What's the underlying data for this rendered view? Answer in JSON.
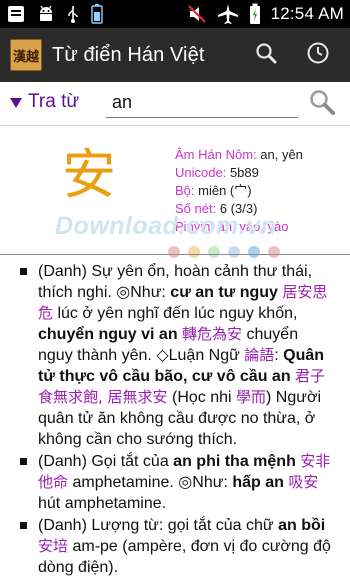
{
  "status_bar": {
    "time": "12:54 AM",
    "icons": [
      "notification-icon",
      "android-icon",
      "usb-icon",
      "battery-saver-icon",
      "mute-icon",
      "airplane-icon",
      "battery-icon"
    ]
  },
  "action_bar": {
    "logo_text": "漢越",
    "title": "Từ điển Hán Việt",
    "icons": [
      "search-icon",
      "history-icon"
    ]
  },
  "search": {
    "mode_label": "Tra từ",
    "query": "an"
  },
  "entry": {
    "character": "安",
    "labels": {
      "han_nom": "Âm Hán Nôm:",
      "unicode": "Unicode:",
      "radical": "Bộ:",
      "strokes": "Số nét:",
      "pinyin": "Pinyin:"
    },
    "values": {
      "han_nom": "an, yên",
      "unicode": "5b89",
      "radical": "miên (宀)",
      "strokes": "6 (3/3)",
      "pinyin": "ān, yāo, yào"
    }
  },
  "watermark": "Download.com.vn",
  "watermark_dot_colors": [
    "#f0c0c0",
    "#f4d8a8",
    "#c8e8c8",
    "#c8dcf0",
    "#a8d0f0",
    "#f0c0c0"
  ],
  "definitions": [
    {
      "parts": [
        {
          "t": "(Danh) Sự yên ổn, hoàn cảnh thư thái, thích nghi. ◎Như: ",
          "s": "n"
        },
        {
          "t": "cư an tư nguy",
          "s": "b"
        },
        {
          "t": " ",
          "s": "n"
        },
        {
          "t": "居安思危",
          "s": "c"
        },
        {
          "t": " lúc ở yên nghĩ đến lúc nguy khốn, ",
          "s": "n"
        },
        {
          "t": "chuyển nguy vi an",
          "s": "b"
        },
        {
          "t": " ",
          "s": "n"
        },
        {
          "t": "轉危為安",
          "s": "c"
        },
        {
          "t": " chuyển nguy thành yên. ◇Luận Ngữ ",
          "s": "n"
        },
        {
          "t": "論語",
          "s": "c"
        },
        {
          "t": ": ",
          "s": "n"
        },
        {
          "t": "Quân tử thực vô cầu bão, cư vô cầu an",
          "s": "b"
        },
        {
          "t": " ",
          "s": "n"
        },
        {
          "t": "君子食無求飽, 居無求安",
          "s": "c"
        },
        {
          "t": " (Học nhi ",
          "s": "n"
        },
        {
          "t": "學而",
          "s": "c"
        },
        {
          "t": ") Người quân tử ăn không cầu được no thừa, ở không cần cho sướng thích.",
          "s": "n"
        }
      ]
    },
    {
      "parts": [
        {
          "t": "(Danh) Gọi tắt của ",
          "s": "n"
        },
        {
          "t": "an phi tha mệnh",
          "s": "b"
        },
        {
          "t": " ",
          "s": "n"
        },
        {
          "t": "安非他命",
          "s": "c"
        },
        {
          "t": " amphetamine. ◎Như: ",
          "s": "n"
        },
        {
          "t": "hấp an",
          "s": "b"
        },
        {
          "t": " ",
          "s": "n"
        },
        {
          "t": "吸安",
          "s": "c"
        },
        {
          "t": " hút amphetamine.",
          "s": "n"
        }
      ]
    },
    {
      "parts": [
        {
          "t": "(Danh) Lượng từ: gọi tắt của chữ ",
          "s": "n"
        },
        {
          "t": "an bồi",
          "s": "b"
        },
        {
          "t": " ",
          "s": "n"
        },
        {
          "t": "安培",
          "s": "c"
        },
        {
          "t": " am-pe (ampère, đơn vị đo cường độ dòng điện).",
          "s": "n"
        }
      ]
    }
  ]
}
